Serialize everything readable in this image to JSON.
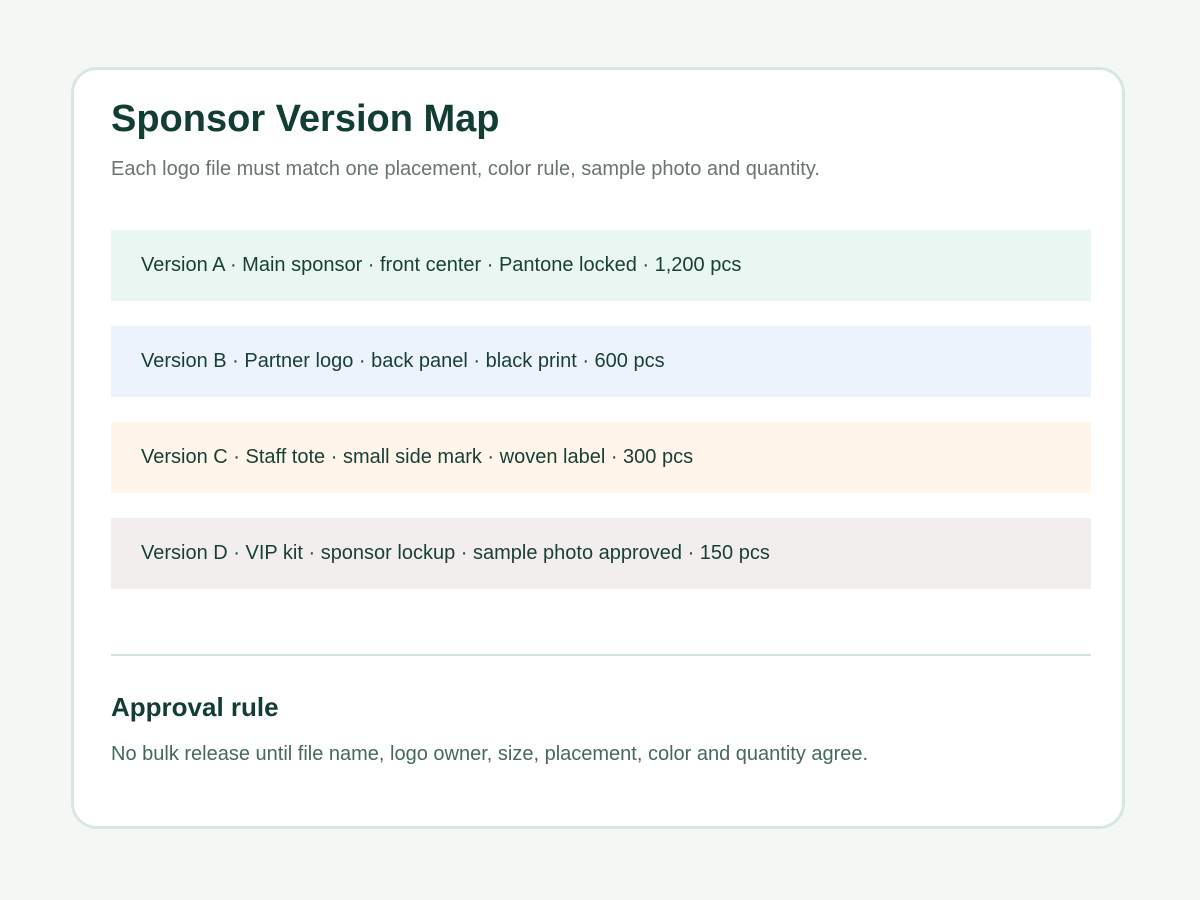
{
  "header": {
    "title": "Sponsor Version Map",
    "subtitle": "Each logo file must match one placement, color rule, sample photo and quantity."
  },
  "versions": [
    {
      "text": "Version A · Main sponsor · front center · Pantone locked · 1,200 pcs",
      "background": "#e9f6f1"
    },
    {
      "text": "Version B · Partner logo · back panel · black print · 600 pcs",
      "background": "#edf3fc"
    },
    {
      "text": "Version C · Staff tote · small side mark · woven label · 300 pcs",
      "background": "#fff5ea"
    },
    {
      "text": "Version D · VIP kit · sponsor lockup · sample photo approved · 150 pcs",
      "background": "#f3eeee"
    }
  ],
  "approval": {
    "heading": "Approval rule",
    "text": "No bulk release until file name, logo owner, size, placement, color and quantity agree."
  },
  "colors": {
    "page_background": "#f5f7f4",
    "card_border": "#d6e8e1",
    "heading_text": "#123d33",
    "body_text": "#476860"
  }
}
